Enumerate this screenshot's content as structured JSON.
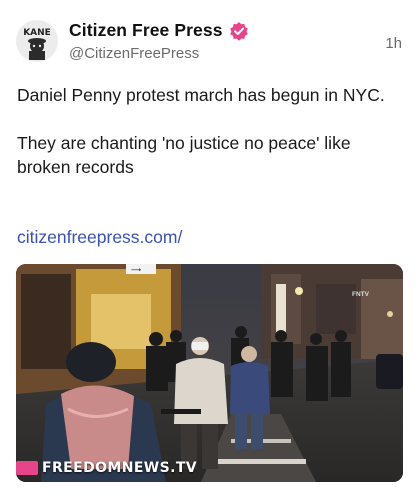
{
  "post": {
    "author": {
      "display_name": "Citizen Free Press",
      "handle": "@CitizenFreePress",
      "avatar_icon": "kane-avatar-icon",
      "verified_color": "#e8448c"
    },
    "timestamp": "1h",
    "text_paragraphs": [
      "Daniel Penny protest march has begun in NYC.",
      "They are chanting 'no justice no peace' like broken records"
    ],
    "link": "citizenfreepress.com/",
    "link_color": "#3a52b8",
    "media": {
      "watermark": "FREEDOMNEWS.TV",
      "watermark_color": "#e8448c",
      "store_sign": "FNTV"
    }
  }
}
